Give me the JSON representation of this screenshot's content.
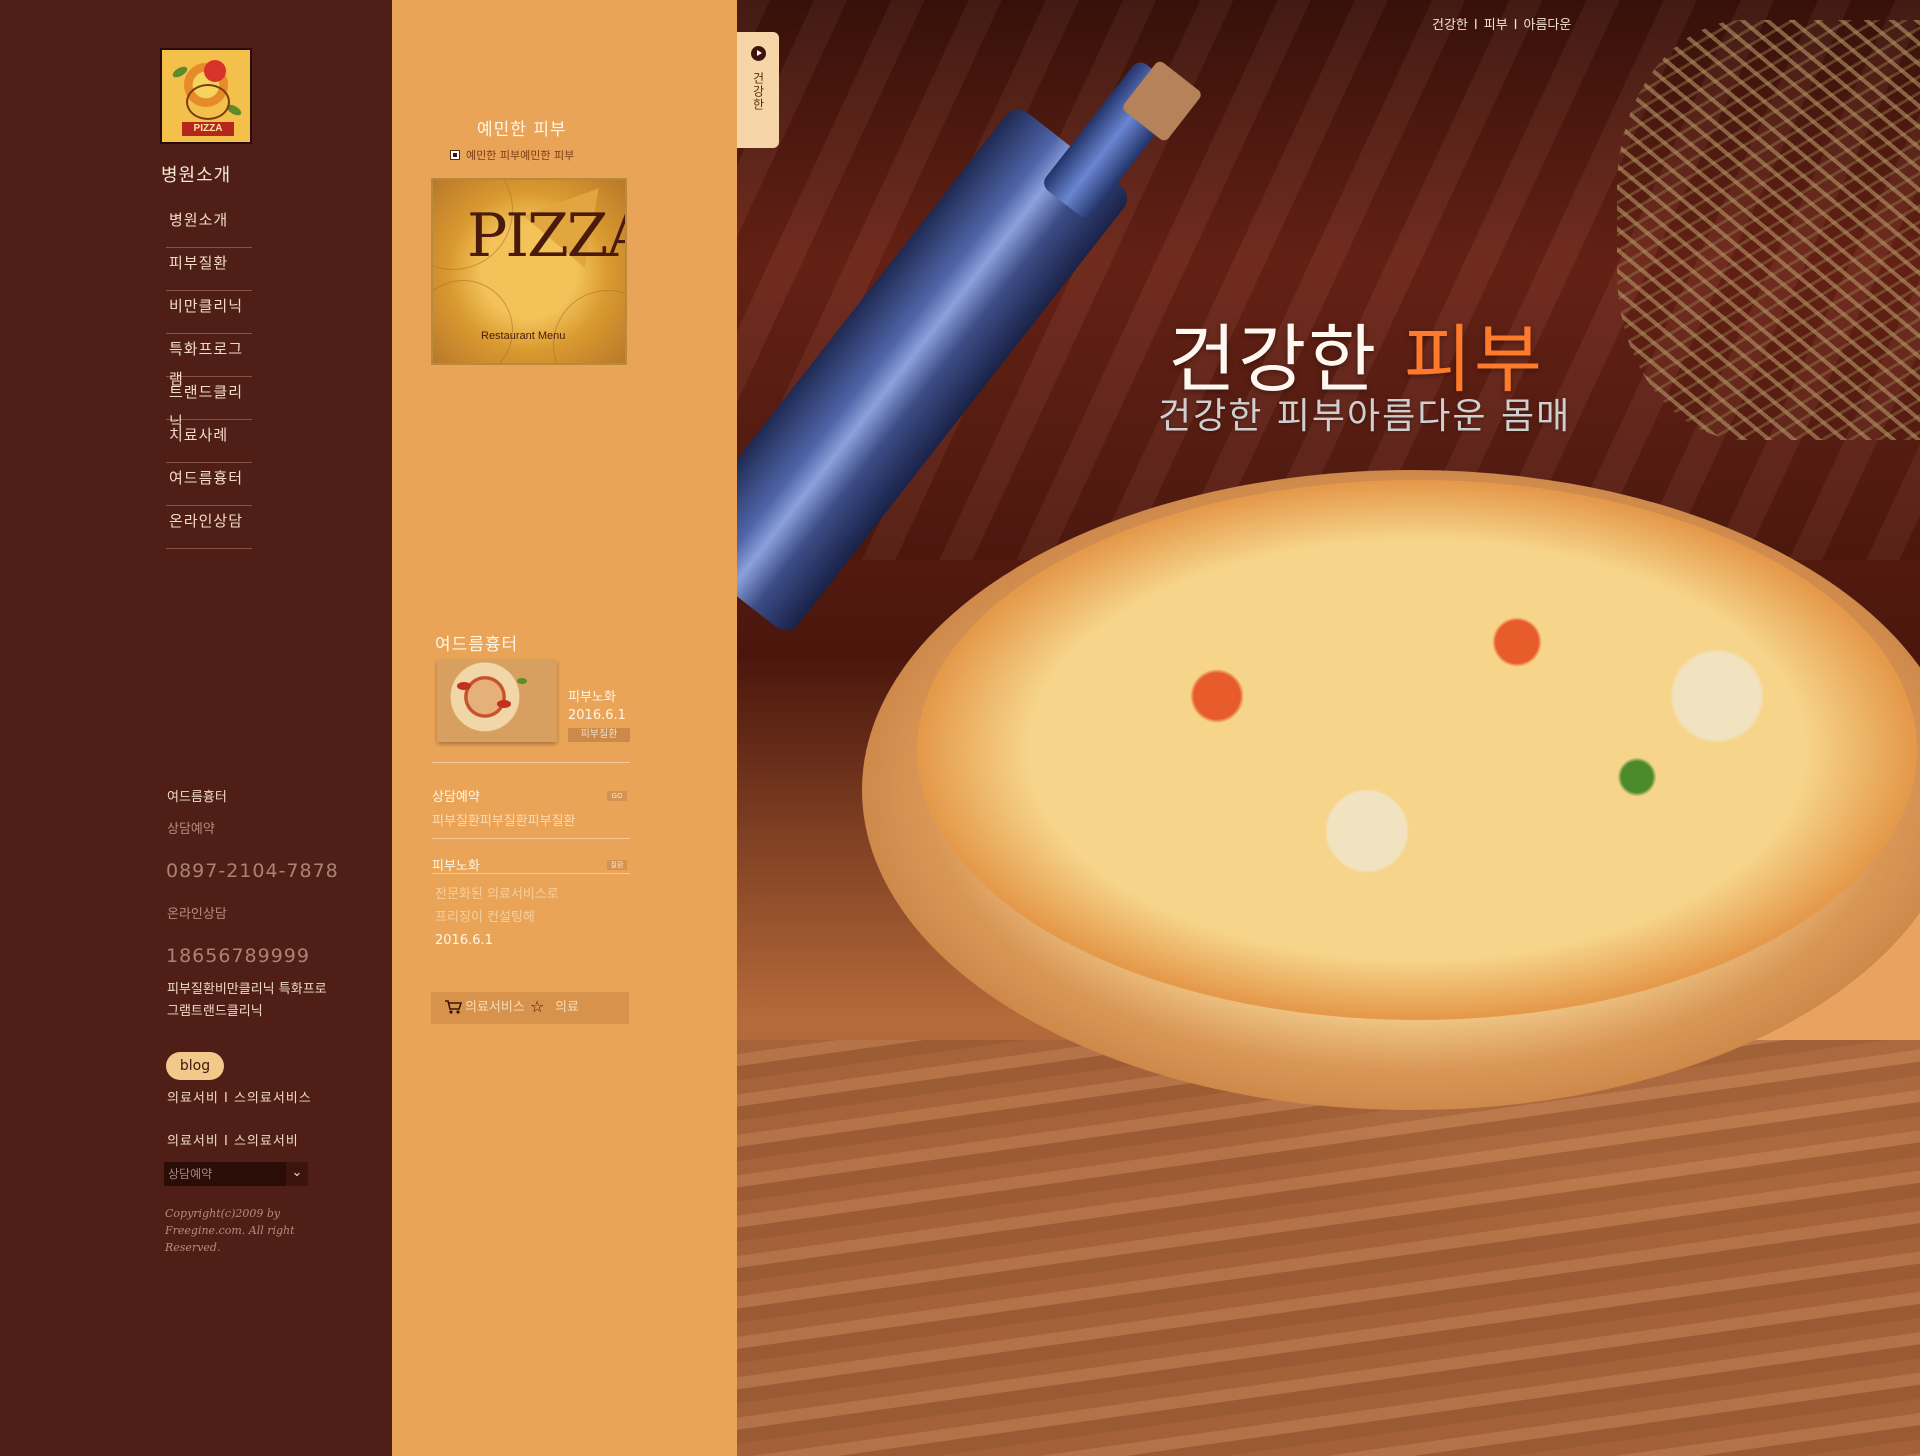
{
  "sidebar": {
    "logo_text": "PIZZA",
    "title": "병원소개",
    "nav": [
      "병원소개",
      "피부질환",
      "비만클리닉",
      "특화프로그램",
      "트랜드클리닉",
      "치료사례",
      "여드름흉터",
      "온라인상담"
    ],
    "contact_title": "여드름흉터",
    "reserve_label": "상담예약",
    "phone1": "0897-2104-7878",
    "online_label": "온라인상담",
    "phone2": "18656789999",
    "links_text": "피부질환비만클리닉 특화프로그램트랜드클리닉",
    "blog_label": "blog",
    "row1": "의료서비 I 스의료서비스",
    "row2": "의료서비 I 스의료서비",
    "select_value": "상담예약",
    "copyright": "Copyright(c)2009 by Freegine.com. All right Reserved."
  },
  "middle": {
    "title": "예민한 피부",
    "subtitle": "예민한 피부예민한 피부",
    "card_big": "PIZZA",
    "card_sub": "Restaurant Menu",
    "news_title": "여드름흉터",
    "news_name": "피부노화",
    "news_date": "2016.6.1",
    "news_tag": "피부질환",
    "consult_title": "상담예약",
    "consult_badge": "GO",
    "consult_text": "피부질환피부질환피부질환",
    "aging_title": "피부노화",
    "aging_badge": "질환",
    "aging_body_1": "전문화된 의료서비스로",
    "aging_body_2": "프리징이 컨설팅해",
    "aging_date": "2016.6.1",
    "svc_1": "의료서비스",
    "svc_2": "의료"
  },
  "hero": {
    "top_link_1": "건강한",
    "top_link_2": "피부",
    "top_link_3": "아름다운",
    "side_tab": "건강한",
    "title_main": "건강한",
    "title_accent": "피부",
    "subtitle": "건강한 피부아름다운 몸매"
  }
}
